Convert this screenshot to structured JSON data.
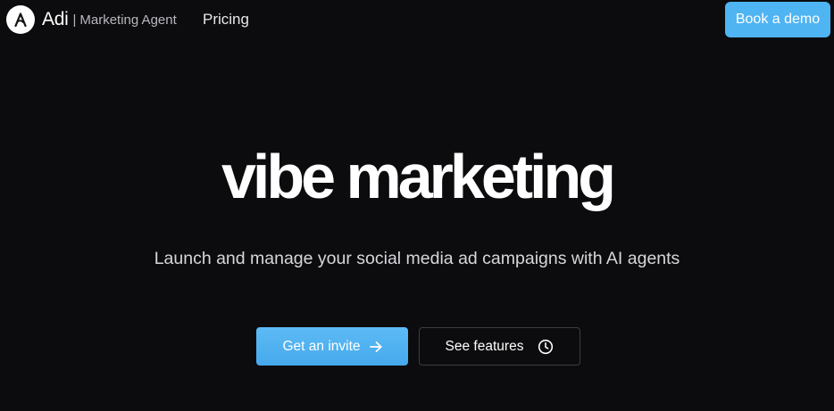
{
  "header": {
    "brand_name": "Adi",
    "brand_separator": "|",
    "brand_tagline": "Marketing Agent",
    "logo_icon": "letter-a-logo",
    "nav": [
      {
        "label": "Pricing"
      }
    ],
    "demo_button_label": "Book a demo"
  },
  "hero": {
    "title": "vibe marketing",
    "subtitle": "Launch and manage your social media ad campaigns with AI agents"
  },
  "cta": {
    "primary_label": "Get an invite",
    "primary_icon": "arrow-right-icon",
    "secondary_label": "See features",
    "secondary_icon": "clock-icon"
  },
  "colors": {
    "background": "#0c0c0f",
    "accent": "#4fb4f2",
    "text": "#ffffff",
    "muted_text": "#b8b8bd"
  }
}
